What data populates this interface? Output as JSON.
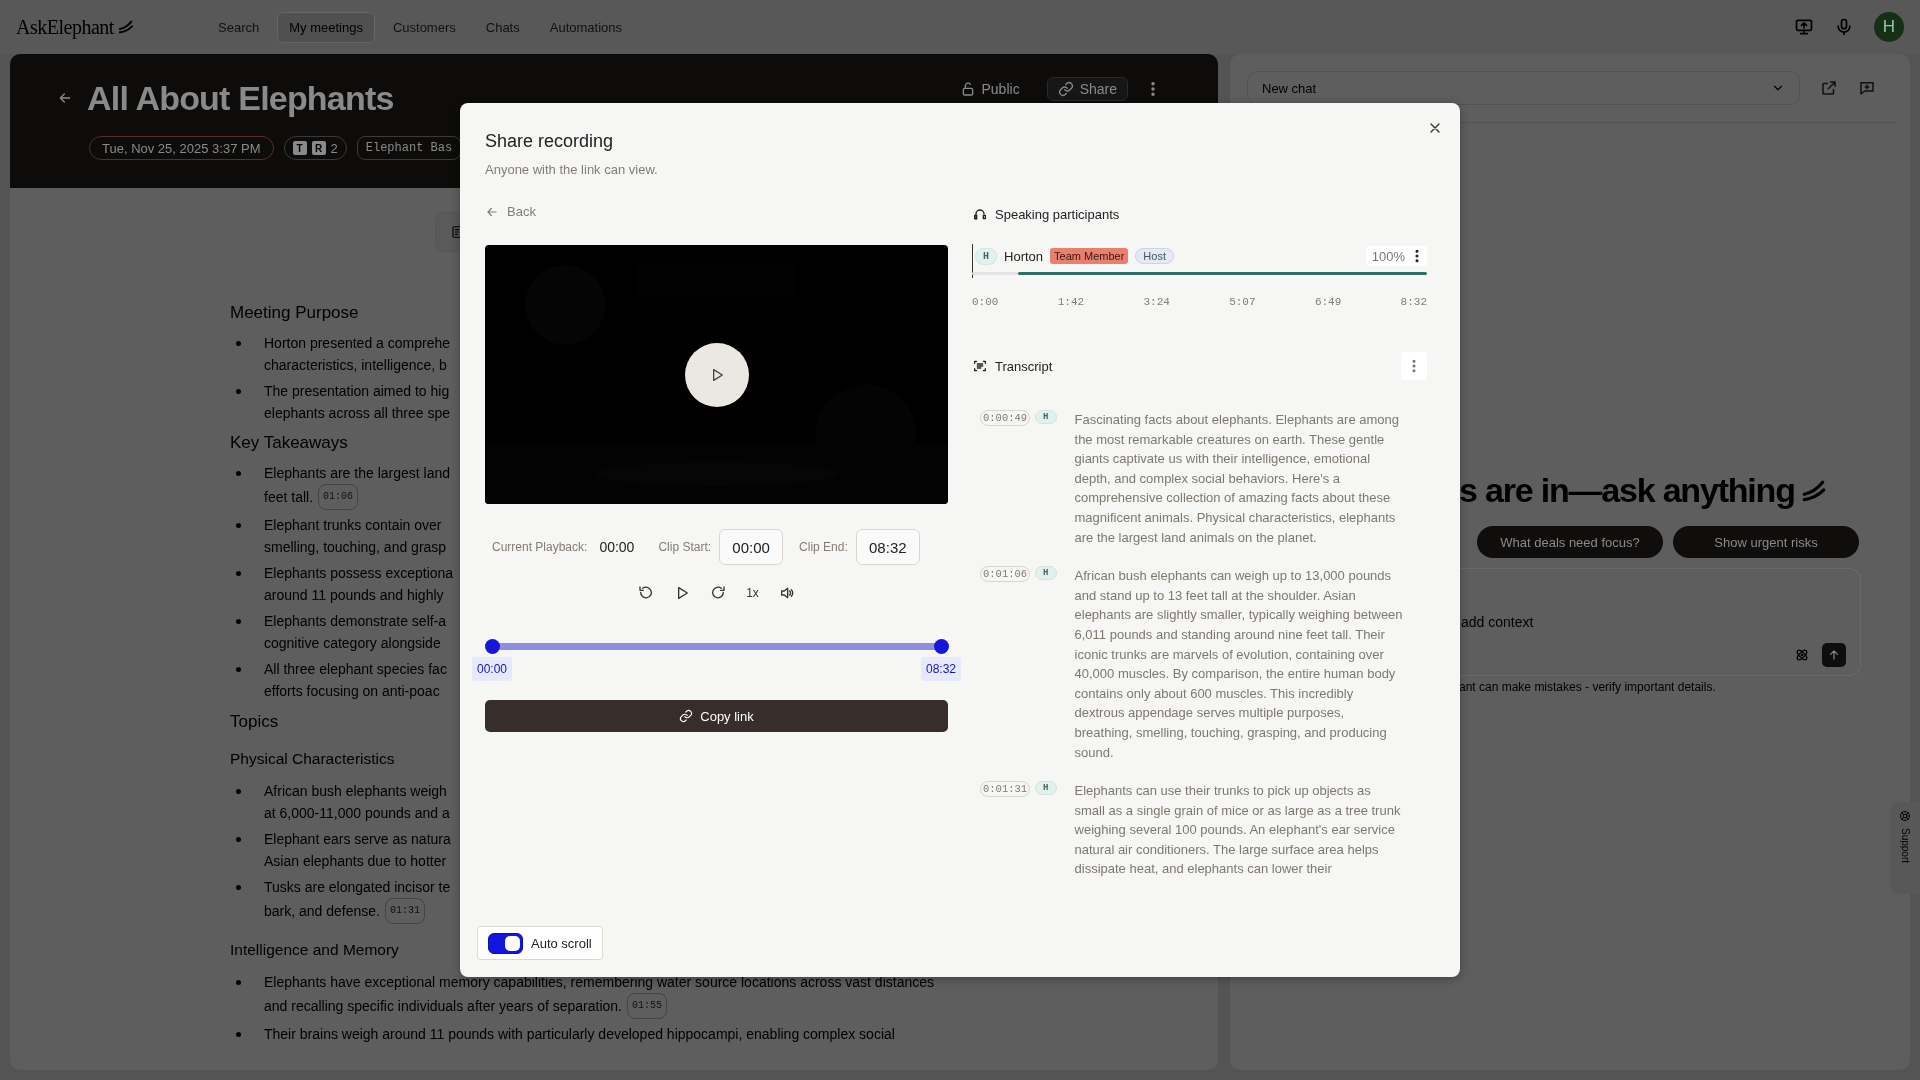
{
  "top_nav": {
    "logo": "AskElephant",
    "items": [
      {
        "label": "Search",
        "selected": false
      },
      {
        "label": "My meetings",
        "selected": true
      },
      {
        "label": "Customers",
        "selected": false
      },
      {
        "label": "Chats",
        "selected": false
      },
      {
        "label": "Automations",
        "selected": false
      }
    ],
    "avatar": "H"
  },
  "meeting": {
    "title": "All About Elephants",
    "public_label": "Public",
    "share_label": "Share",
    "date_chip": "Tue, Nov 25, 2025 3:37 PM",
    "participant_initials": [
      "T",
      "R"
    ],
    "participant_count": "2",
    "tag_chip": "Elephant Bas",
    "notes": [
      {
        "kind": "heading",
        "text": "Meeting Purpose"
      },
      {
        "kind": "bullet",
        "lines": [
          "Horton presented a comprehe",
          "characteristics, intelligence, b"
        ]
      },
      {
        "kind": "bullet",
        "lines": [
          "The presentation aimed to hig",
          "elephants across all three spe"
        ]
      },
      {
        "kind": "heading",
        "text": "Key Takeaways"
      },
      {
        "kind": "bullet",
        "lines": [
          "Elephants are the largest land",
          "feet tall."
        ],
        "timestamp": "01:06"
      },
      {
        "kind": "bullet",
        "lines": [
          "Elephant trunks contain over",
          "smelling, touching, and grasp"
        ]
      },
      {
        "kind": "bullet",
        "lines": [
          "Elephants possess exceptiona",
          "around 11 pounds and highly"
        ]
      },
      {
        "kind": "bullet",
        "lines": [
          "Elephants demonstrate self-a",
          "cognitive category alongside"
        ]
      },
      {
        "kind": "bullet",
        "lines": [
          "All three elephant species fac",
          "efforts focusing on anti-poac"
        ]
      },
      {
        "kind": "section",
        "text": "Topics"
      },
      {
        "kind": "subheading",
        "text": "Physical Characteristics"
      },
      {
        "kind": "bullet",
        "lines": [
          "African bush elephants weigh",
          "at 6,000-11,000 pounds and a"
        ]
      },
      {
        "kind": "bullet",
        "lines": [
          "Elephant ears serve as natura",
          "Asian elephants due to hotter"
        ]
      },
      {
        "kind": "bullet",
        "lines": [
          "Tusks are elongated incisor te",
          "bark, and defense."
        ],
        "timestamp": "01:31"
      },
      {
        "kind": "subheading",
        "text": "Intelligence and Memory"
      },
      {
        "kind": "bullet",
        "lines": [
          "Elephants have exceptional memory capabilities, remembering water source locations across vast distances",
          "and recalling specific individuals after years of separation."
        ],
        "timestamp": "01:55"
      },
      {
        "kind": "bullet",
        "lines": [
          "Their brains weigh around 11 pounds with particularly developed hippocampi, enabling complex social"
        ]
      }
    ]
  },
  "chat": {
    "dropdown": "New chat",
    "headline": "s are in—ask anything",
    "suggestions": [
      "What deals need focus?",
      "Show urgent risks"
    ],
    "placeholder": "add context",
    "disclaimer": "ant can make mistakes - verify important details.",
    "support": "Support"
  },
  "share_dialog": {
    "title": "Share recording",
    "subtitle": "Anyone with the link can view.",
    "back": "Back",
    "current_playback_label": "Current Playback:",
    "current_playback": "00:00",
    "clip_start_label": "Clip Start:",
    "clip_start": "00:00",
    "clip_end_label": "Clip End:",
    "clip_end": "08:32",
    "speed": "1x",
    "clip_handles": [
      {
        "label": "00:00",
        "level": 0
      },
      {
        "label": "08:32",
        "level": 1
      }
    ],
    "copy_link": "Copy link",
    "auto_scroll": {
      "label": "Auto scroll",
      "on": true
    },
    "participants_heading": "Speaking participants",
    "participants": [
      {
        "initial": "H",
        "name": "Horton",
        "tags": [
          {
            "kind": "role",
            "text": "Team Member"
          },
          {
            "kind": "host",
            "text": "Host"
          }
        ],
        "share": "100%"
      }
    ],
    "timeline_ticks": [
      "0:00",
      "1:42",
      "3:24",
      "5:07",
      "6:49",
      "8:32"
    ],
    "transcript_heading": "Transcript",
    "transcript": [
      {
        "time": "0:00:49",
        "speaker": "H",
        "text": "Fascinating facts about elephants. Elephants are among the most remarkable creatures on earth. These gentle giants captivate us with their intelligence, emotional depth, and complex social behaviors. Here's a comprehensive collection of amazing facts about these magnificent animals. Physical characteristics, elephants are the largest land animals on the planet."
      },
      {
        "time": "0:01:06",
        "speaker": "H",
        "text": "African bush elephants can weigh up to 13,000 pounds and stand up to 13 feet tall at the shoulder. Asian elephants are slightly smaller, typically weighing between 6,011 pounds and standing around nine feet tall. Their iconic trunks are marvels of evolution, containing over 40,000 muscles. By comparison, the entire human body contains only about 600 muscles. This incredibly dextrous appendage serves multiple purposes, breathing, smelling, touching, grasping, and producing sound."
      },
      {
        "time": "0:01:31",
        "speaker": "H",
        "text": "Elephants can use their trunks to pick up objects as small as a single grain of mice or as large as a tree trunk weighing several 100 pounds. An elephant's ear service natural air conditioners. The large surface area helps dissipate heat, and elephants can lower their"
      }
    ]
  }
}
